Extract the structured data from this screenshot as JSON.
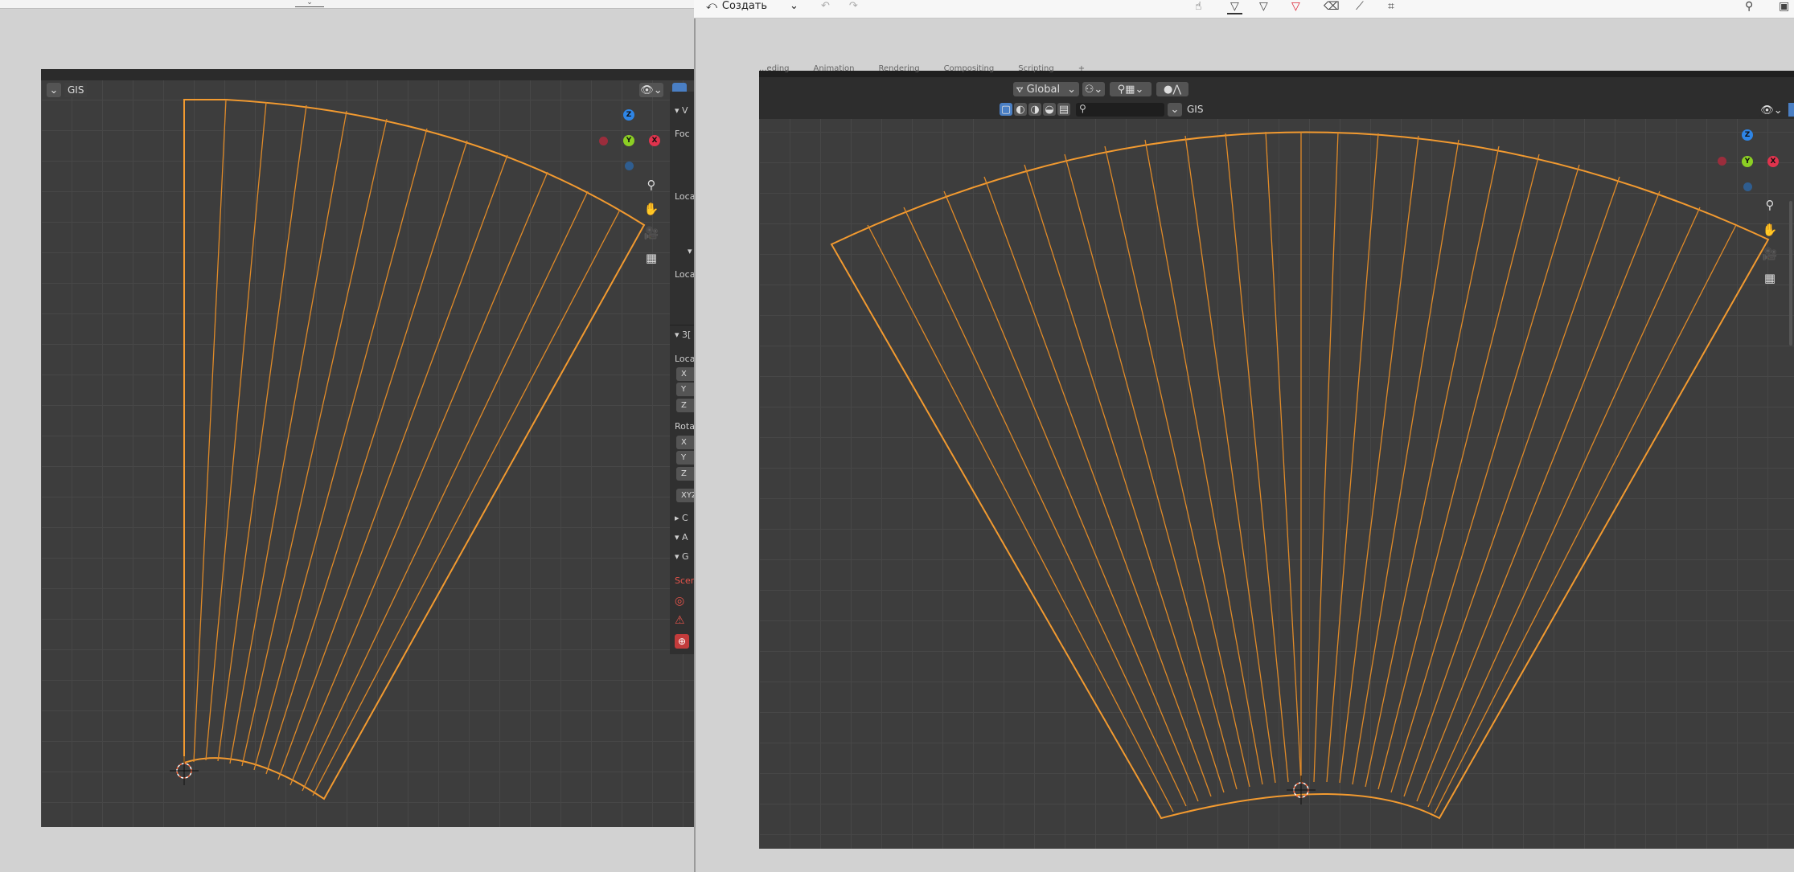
{
  "left_window": {
    "viewport_label": "GIS",
    "npanel": {
      "focal_label": "Foc",
      "loca_1": "Loca",
      "loca_2": "Loca",
      "section_3d": "3[",
      "loca_3": "Loca",
      "x": "X",
      "y": "Y",
      "z": "Z",
      "rota": "Rota",
      "rx": "X",
      "ry": "Y",
      "rz": "Z",
      "xyz": "XYZ",
      "c": "C",
      "a": "A",
      "g": "G",
      "scen": "Scen",
      "v": "V"
    },
    "gizmo": {
      "z": "Z",
      "y": "Y",
      "x": "X"
    }
  },
  "right_window": {
    "toolbar": {
      "create_label": "Создать"
    },
    "tabs": [
      "...eding",
      "Animation",
      "Rendering",
      "Compositing",
      "Scripting",
      "+"
    ],
    "header": {
      "transform_orientation": "Global",
      "gis_label": "GIS",
      "search_placeholder": ""
    },
    "gizmo": {
      "z": "Z",
      "y": "Y",
      "x": "X"
    }
  },
  "colors": {
    "wire_orange": "#f29a30",
    "viewport_bg": "#3d3d3d",
    "grid_line": "#474747",
    "axis_x": "#e0334d",
    "axis_y": "#8ccf24",
    "axis_z": "#2e85e6"
  }
}
